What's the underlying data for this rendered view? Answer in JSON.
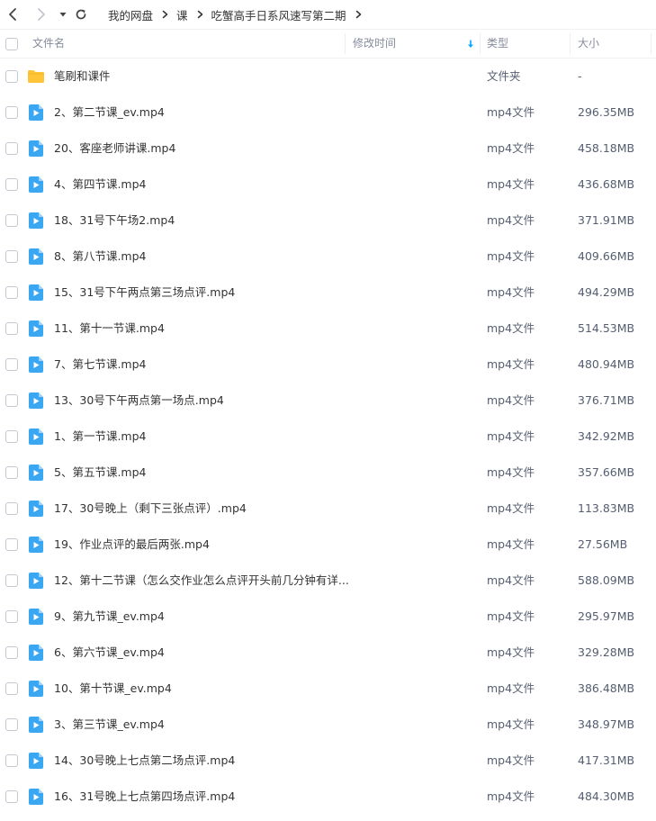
{
  "toolbar": {
    "back_icon": "chevron-left-icon",
    "forward_icon": "chevron-right-icon",
    "history_icon": "caret-down-icon",
    "refresh_icon": "refresh-icon",
    "breadcrumb": [
      "我的网盘",
      "课",
      "吃蟹高手日系风速写第二期"
    ]
  },
  "columns": {
    "name": "文件名",
    "modified": "修改时间",
    "type": "类型",
    "size": "大小",
    "sort_icon": "sort-down-icon"
  },
  "colors": {
    "accent": "#06a7ff",
    "folder": "#ffc536",
    "video_icon": "#3aa7f2"
  },
  "files": [
    {
      "name": "笔刷和课件",
      "type": "文件夹",
      "size": "-",
      "icon": "folder-icon"
    },
    {
      "name": "2、第二节课_ev.mp4",
      "type": "mp4文件",
      "size": "296.35MB",
      "icon": "video-file-icon"
    },
    {
      "name": "20、客座老师讲课.mp4",
      "type": "mp4文件",
      "size": "458.18MB",
      "icon": "video-file-icon"
    },
    {
      "name": "4、第四节课.mp4",
      "type": "mp4文件",
      "size": "436.68MB",
      "icon": "video-file-icon"
    },
    {
      "name": "18、31号下午场2.mp4",
      "type": "mp4文件",
      "size": "371.91MB",
      "icon": "video-file-icon"
    },
    {
      "name": "8、第八节课.mp4",
      "type": "mp4文件",
      "size": "409.66MB",
      "icon": "video-file-icon"
    },
    {
      "name": "15、31号下午两点第三场点评.mp4",
      "type": "mp4文件",
      "size": "494.29MB",
      "icon": "video-file-icon"
    },
    {
      "name": "11、第十一节课.mp4",
      "type": "mp4文件",
      "size": "514.53MB",
      "icon": "video-file-icon"
    },
    {
      "name": "7、第七节课.mp4",
      "type": "mp4文件",
      "size": "480.94MB",
      "icon": "video-file-icon"
    },
    {
      "name": "13、30号下午两点第一场点.mp4",
      "type": "mp4文件",
      "size": "376.71MB",
      "icon": "video-file-icon"
    },
    {
      "name": "1、第一节课.mp4",
      "type": "mp4文件",
      "size": "342.92MB",
      "icon": "video-file-icon"
    },
    {
      "name": "5、第五节课.mp4",
      "type": "mp4文件",
      "size": "357.66MB",
      "icon": "video-file-icon"
    },
    {
      "name": "17、30号晚上（剩下三张点评）.mp4",
      "type": "mp4文件",
      "size": "113.83MB",
      "icon": "video-file-icon"
    },
    {
      "name": "19、作业点评的最后两张.mp4",
      "type": "mp4文件",
      "size": "27.56MB",
      "icon": "video-file-icon"
    },
    {
      "name": "12、第十二节课（怎么交作业怎么点评开头前几分钟有详...",
      "type": "mp4文件",
      "size": "588.09MB",
      "icon": "video-file-icon"
    },
    {
      "name": "9、第九节课_ev.mp4",
      "type": "mp4文件",
      "size": "295.97MB",
      "icon": "video-file-icon"
    },
    {
      "name": "6、第六节课_ev.mp4",
      "type": "mp4文件",
      "size": "329.28MB",
      "icon": "video-file-icon"
    },
    {
      "name": "10、第十节课_ev.mp4",
      "type": "mp4文件",
      "size": "386.48MB",
      "icon": "video-file-icon"
    },
    {
      "name": "3、第三节课_ev.mp4",
      "type": "mp4文件",
      "size": "348.97MB",
      "icon": "video-file-icon"
    },
    {
      "name": "14、30号晚上七点第二场点评.mp4",
      "type": "mp4文件",
      "size": "417.31MB",
      "icon": "video-file-icon"
    },
    {
      "name": "16、31号晚上七点第四场点评.mp4",
      "type": "mp4文件",
      "size": "484.30MB",
      "icon": "video-file-icon"
    }
  ]
}
